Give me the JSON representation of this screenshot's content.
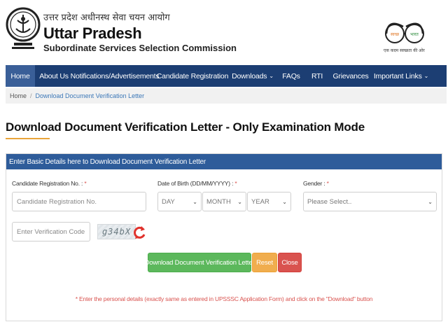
{
  "header": {
    "title_hindi": "उत्तर प्रदेश अधीनस्थ सेवा चयन आयोग",
    "title": "Uttar Pradesh",
    "subtitle": "Subordinate Services Selection Commission",
    "swachh_left": "स्वच्छ",
    "swachh_right": "भारत",
    "swachh_tagline": "एक कदम स्वच्छता की ओर"
  },
  "nav": {
    "items": [
      {
        "label": "Home",
        "active": true
      },
      {
        "label": "About Us"
      },
      {
        "label": "Notifications/Advertisements"
      },
      {
        "label": "Candidate Registration"
      },
      {
        "label": "Downloads",
        "dropdown": true
      },
      {
        "label": "FAQs"
      },
      {
        "label": "RTI"
      },
      {
        "label": "Grievances"
      },
      {
        "label": "Important Links",
        "dropdown": true
      }
    ],
    "caret": "⌄"
  },
  "breadcrumb": {
    "home": "Home",
    "separator": "/",
    "current": "Download Document Verification Letter"
  },
  "page_title": "Download Document Verification Letter - Only Examination Mode",
  "form": {
    "header": "Enter Basic Details here to Download Document Verification Letter",
    "registration_label": "Candidate Registration No. : ",
    "registration_placeholder": "Candidate Registration No.",
    "dob_label": "Date of Birth (DD/MM/YYYY) : ",
    "day": "DAY",
    "month": "MONTH",
    "year": "YEAR",
    "gender_label": "Gender : ",
    "gender_placeholder": "Please Select..",
    "required_mark": "*",
    "verification_placeholder": "Enter Verification Code",
    "captcha_text": "g34bX",
    "download_button": "Download Document Verification Letter",
    "reset_button": "Reset",
    "close_button": "Close",
    "note": "* Enter the personal details (exactly same as entered in UPSSSC Application Form) and click on the \"Download\" button"
  },
  "colors": {
    "nav_bg": "#1c3e73",
    "card_head_bg": "#2e5c9a",
    "accent": "#e9a53a",
    "download": "#5cb85c",
    "reset": "#f0ad4e",
    "close": "#d9534f"
  }
}
